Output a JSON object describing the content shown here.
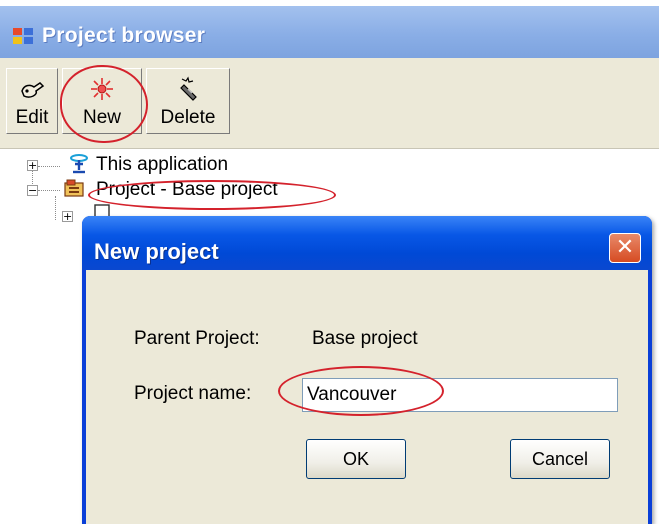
{
  "top_strip": {
    "text": "Project browser"
  },
  "browser": {
    "title": "Project browser",
    "toolbar": {
      "edit_label": "Edit",
      "new_label": "New",
      "delete_label": "Delete"
    },
    "tree": [
      {
        "label": "This application",
        "expander": "+"
      },
      {
        "label": "Project - Base project",
        "expander": "−"
      },
      {
        "label": "",
        "expander": "+"
      }
    ]
  },
  "dialog": {
    "title": "New project",
    "close_glyph": "✕",
    "parent_label": "Parent Project:",
    "parent_value": "Base project",
    "name_label": "Project name:",
    "name_value": "Vancouver",
    "ok_label": "OK",
    "cancel_label": "Cancel"
  },
  "colors": {
    "annotation_circle": "#d4222c",
    "xp_title_blue": "#0857e6",
    "dialog_face": "#ece9d8",
    "close_button": "#d64b22"
  },
  "icons": [
    "window-app-icon",
    "edit-icon",
    "new-icon",
    "delete-icon",
    "application-icon",
    "project-icon",
    "document-icon",
    "close-icon"
  ]
}
